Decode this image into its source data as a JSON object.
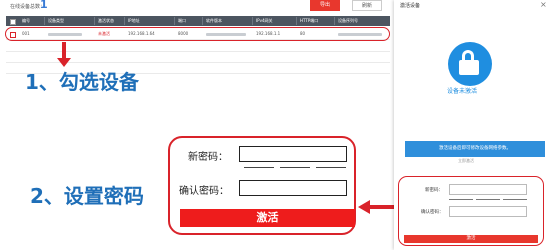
{
  "toolbar": {
    "online_label": "在线设备总数：",
    "online_count": "1",
    "export_label": "导出",
    "refresh_label": "刷新"
  },
  "table": {
    "headers": [
      "编号",
      "设备类型",
      "激活状态",
      "IP地址",
      "端口",
      "软件版本",
      "IPv4网关",
      "HTTP端口",
      "设备序列号"
    ],
    "rows": [
      {
        "cells": [
          "001",
          "",
          "未激活",
          "192.168.1.64",
          "8000",
          "",
          "192.168.1.1",
          "80",
          ""
        ]
      }
    ]
  },
  "annotations": {
    "step1": "1、勾选设备",
    "step2": "2、设置密码"
  },
  "password_zoom": {
    "new_password_label": "新密码：",
    "confirm_password_label": "确认密码：",
    "activate_label": "激活"
  },
  "dialog": {
    "title": "激活设备",
    "close_symbol": "×",
    "status_text": "设备未激活",
    "info_text": "激活设备后即可修改设备网络参数。",
    "info_link": "立即激活",
    "new_password_label": "新密码：",
    "confirm_password_label": "确认密码：",
    "activate_label": "激活"
  },
  "colors": {
    "accent_red": "#d9232a",
    "header_bg": "#4c5560",
    "brand_blue": "#1f8ee0",
    "annotation_blue": "#1f6fb8"
  },
  "icons": [
    "lock-icon",
    "close-icon",
    "arrow-down-icon",
    "arrow-left-icon"
  ]
}
